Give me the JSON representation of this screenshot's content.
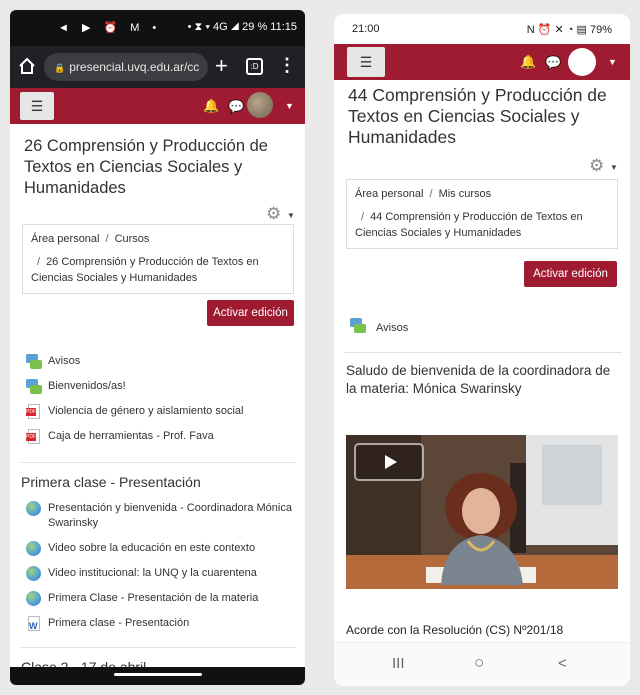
{
  "left": {
    "status": {
      "icons": "◄ ▶ ⏰ M •",
      "right": "• ⧗ ▾ 4G ◢ 29 % 11:15"
    },
    "browser": {
      "url": "presencial.uvq.edu.ar/cc",
      "tabs_count": ":D"
    },
    "course_title": "26 Comprensión y Producción de Textos en Ciencias Sociales y Humanidades",
    "breadcrumb": {
      "home": "Área personal",
      "courses": "Cursos",
      "current": "26 Comprensión y Producción de Textos en Ciencias Sociales y Humanidades"
    },
    "edit_button": "Activar edición",
    "activities": [
      {
        "label": "Avisos",
        "icon": "forum-icon"
      },
      {
        "label": "Bienvenidos/as!",
        "icon": "forum-icon"
      },
      {
        "label": "Violencia de género y aislamiento social",
        "icon": "pdf-icon"
      },
      {
        "label": "Caja de herramientas - Prof. Fava",
        "icon": "pdf-icon"
      }
    ],
    "section1": {
      "title": "Primera clase - Presentación",
      "items": [
        {
          "label": "Presentación y bienvenida - Coordinadora Mónica Swarinsky",
          "icon": "url-icon"
        },
        {
          "label": "Video sobre la educación en este contexto",
          "icon": "url-icon"
        },
        {
          "label": "Video institucional: la UNQ y la cuarentena",
          "icon": "url-icon"
        },
        {
          "label": "Primera Clase - Presentación de la materia",
          "icon": "url-icon"
        },
        {
          "label": "Primera clase - Presentación",
          "icon": "word-icon"
        }
      ]
    },
    "next_section_partial": "Clase 2 - 17 de abril"
  },
  "right": {
    "status": {
      "time": "21:00",
      "right": "N ⏰ ✕ ◔ ▤ 79%"
    },
    "course_title": "44 Comprensión y Producción de Textos en Ciencias Sociales y Humanidades",
    "breadcrumb": {
      "home": "Área personal",
      "courses": "Mis cursos",
      "current": "44 Comprensión y Producción de Textos en Ciencias Sociales y Humanidades"
    },
    "edit_button": "Activar edición",
    "activity": "Avisos",
    "welcome": "Saludo de bienvenida de la coordinadora de la materia: Mónica Swarinsky",
    "resolution": "Acorde con la Resolución (CS) Nº201/18",
    "sysnav": {
      "recent": "III",
      "home": "○",
      "back": "<"
    }
  },
  "colors": {
    "brand": "#9e1b32",
    "hamburger_bg": "#e6e6e6"
  }
}
